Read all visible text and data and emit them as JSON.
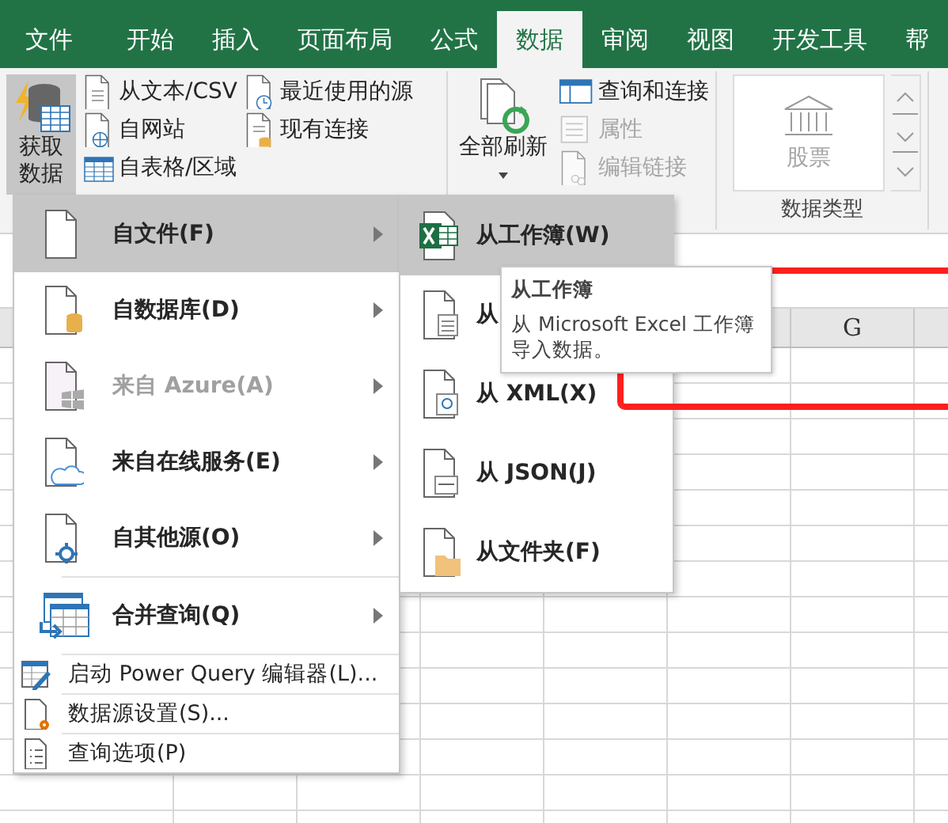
{
  "tabs": [
    {
      "label": "文件",
      "selected": false
    },
    {
      "label": "开始",
      "selected": false
    },
    {
      "label": "插入",
      "selected": false
    },
    {
      "label": "页面布局",
      "selected": false
    },
    {
      "label": "公式",
      "selected": false
    },
    {
      "label": "数据",
      "selected": true
    },
    {
      "label": "审阅",
      "selected": false
    },
    {
      "label": "视图",
      "selected": false
    },
    {
      "label": "开发工具",
      "selected": false
    },
    {
      "label": "帮",
      "selected": false
    }
  ],
  "ribbon": {
    "get_data": {
      "label": "获取数据",
      "pressed": true
    },
    "get_buttons": [
      {
        "label": "从文本/CSV",
        "disabled": false
      },
      {
        "label": "自网站",
        "disabled": false
      },
      {
        "label": "自表格/区域",
        "disabled": false
      },
      {
        "label": "最近使用的源",
        "disabled": false
      },
      {
        "label": "现有连接",
        "disabled": false
      }
    ],
    "refresh_all": {
      "label": "全部刷新"
    },
    "query_buttons": [
      {
        "label": "查询和连接",
        "disabled": false
      },
      {
        "label": "属性",
        "disabled": true
      },
      {
        "label": "编辑链接",
        "disabled": true
      }
    ],
    "data_types": {
      "item": {
        "label": "股票",
        "disabled": true
      },
      "group_label": "数据类型"
    }
  },
  "sheet": {
    "column_header": "G"
  },
  "get_data_menu": {
    "items": [
      {
        "label": "自文件(F)",
        "kind": "large",
        "selected": true,
        "disabled": false
      },
      {
        "label": "自数据库(D)",
        "kind": "large",
        "selected": false,
        "disabled": false
      },
      {
        "label": "来自 Azure(A)",
        "kind": "large",
        "selected": false,
        "disabled": true
      },
      {
        "label": "来自在线服务(E)",
        "kind": "large",
        "selected": false,
        "disabled": false
      },
      {
        "label": "自其他源(O)",
        "kind": "large",
        "selected": false,
        "disabled": false
      },
      {
        "label": "合并查询(Q)",
        "kind": "large",
        "selected": false,
        "disabled": false
      },
      {
        "label": "启动 Power Query 编辑器(L)...",
        "kind": "small",
        "selected": false,
        "disabled": false
      },
      {
        "label": "数据源设置(S)...",
        "kind": "small",
        "selected": false,
        "disabled": false
      },
      {
        "label": "查询选项(P)",
        "kind": "small",
        "selected": false,
        "disabled": false
      }
    ]
  },
  "file_submenu": {
    "items": [
      {
        "label": "从工作簿(W)",
        "selected": true
      },
      {
        "label": "从",
        "selected": false
      },
      {
        "label": "从 XML(X)",
        "selected": false
      },
      {
        "label": "从 JSON(J)",
        "selected": false
      },
      {
        "label": "从文件夹(F)",
        "selected": false
      }
    ]
  },
  "tooltip": {
    "title": "从工作簿",
    "text": "从 Microsoft Excel 工作簿导入数据。"
  }
}
